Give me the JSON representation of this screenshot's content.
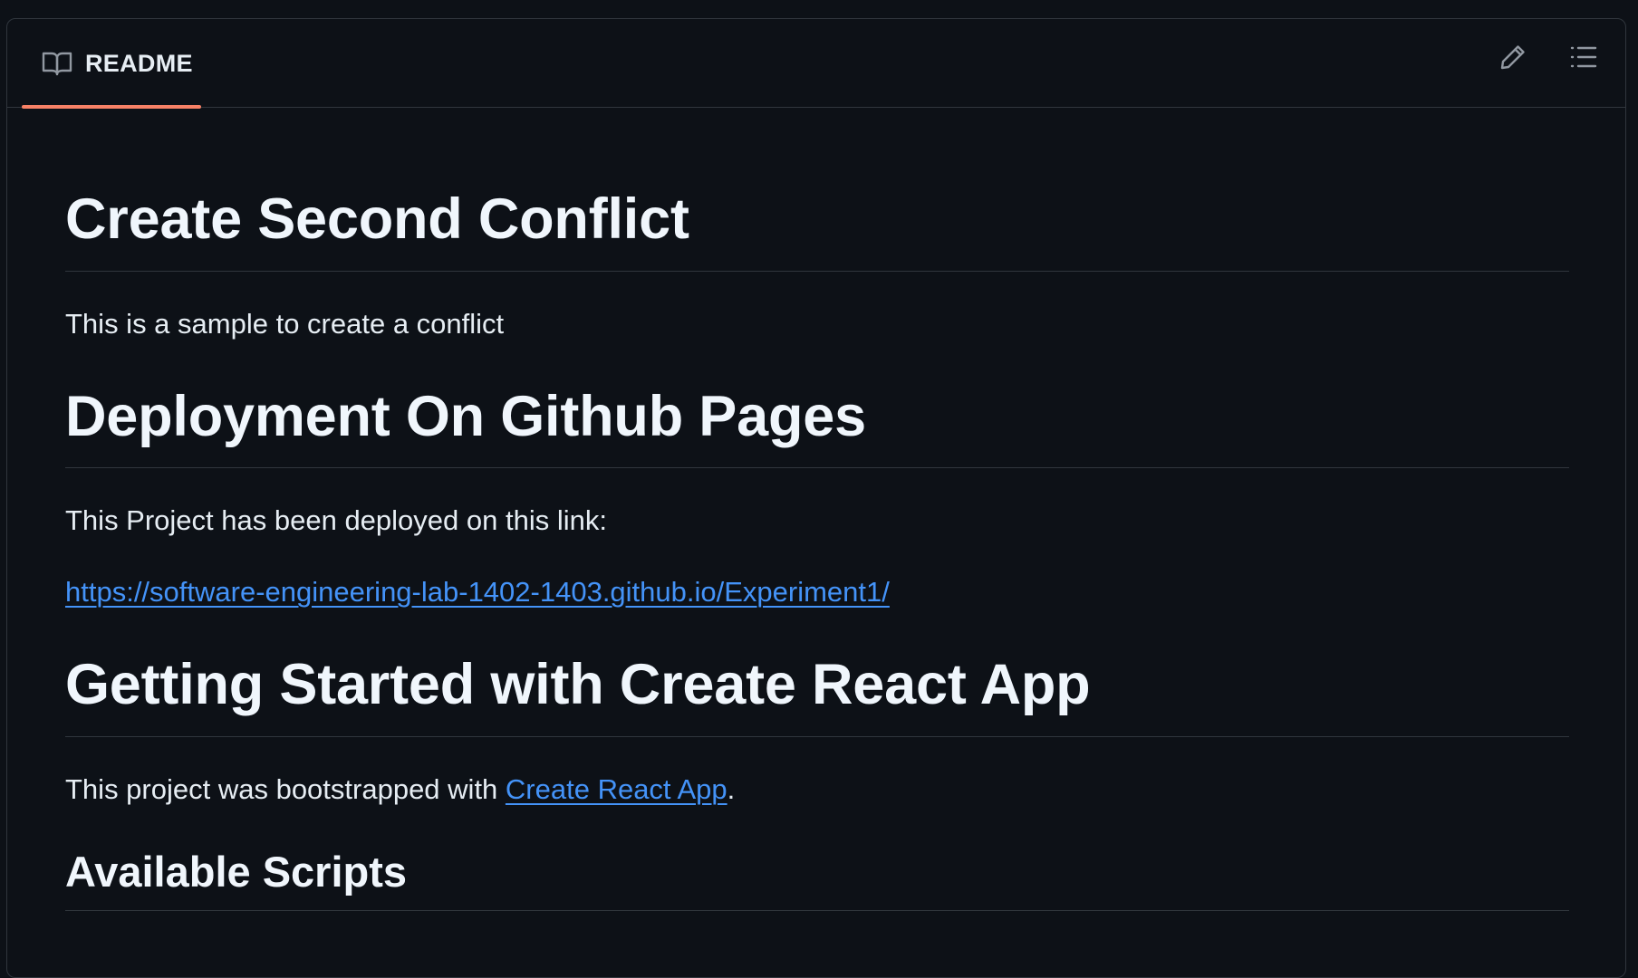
{
  "readme": {
    "tab_label": "README",
    "tab_icon": "book-icon",
    "actions": {
      "edit_icon": "pencil-icon",
      "outline_icon": "list-icon"
    },
    "accent_color": "#f78166",
    "link_color": "#4493f8"
  },
  "content": {
    "h1_conflict": "Create Second Conflict",
    "p_conflict": "This is a sample to create a conflict",
    "h1_deploy": "Deployment On Github Pages",
    "p_deploy": "This Project has been deployed on this link:",
    "deploy_link": "https://software-engineering-lab-1402-1403.github.io/Experiment1/",
    "h1_getting_started": "Getting Started with Create React App",
    "p_boot_prefix": "This project was bootstrapped with ",
    "cra_link": "Create React App",
    "p_boot_suffix": ".",
    "h2_scripts": "Available Scripts"
  }
}
